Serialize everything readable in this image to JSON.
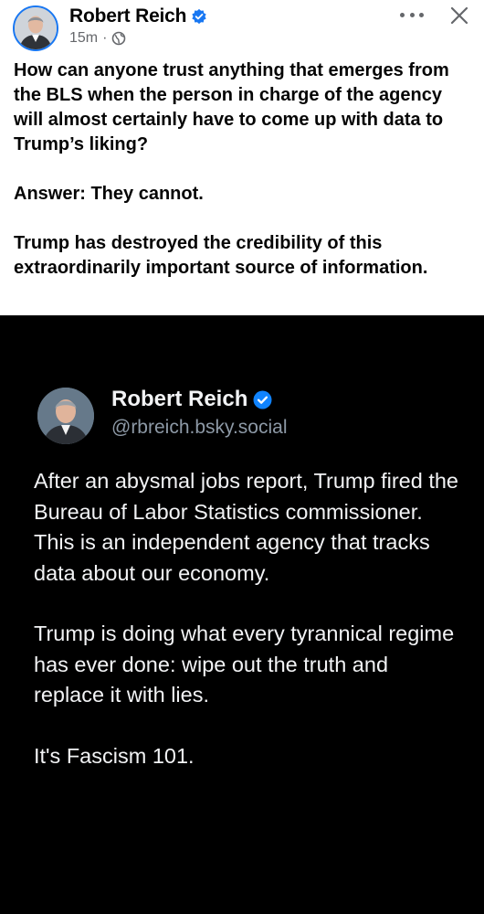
{
  "post": {
    "author": "Robert Reich",
    "time": "15m",
    "separator": "·",
    "icons": {
      "verified": "verified-badge-icon",
      "audience": "globe-icon",
      "more": "more-options-icon",
      "close": "close-icon"
    },
    "paragraphs": [
      "How can anyone trust anything that emerges from the BLS when the person in charge of the agency will almost certainly have to come up with data to Trump’s liking?",
      "Answer: They cannot.",
      "Trump has destroyed the credibility of this extraordinarily important source of information."
    ]
  },
  "embedded_post": {
    "author": "Robert Reich",
    "handle": "@rbreich.bsky.social",
    "paragraphs": [
      "After an abysmal jobs report, Trump fired the Bureau of Labor Statistics commissioner. This is an independent agency that tracks data about our economy.",
      "Trump is doing what every tyrannical regime has ever done: wipe out the truth and replace it with lies.",
      "It's Fascism 101."
    ]
  },
  "colors": {
    "verified_blue": "#1877f2",
    "bsky_verified_blue": "#1083fe",
    "embedded_background": "#000000"
  }
}
